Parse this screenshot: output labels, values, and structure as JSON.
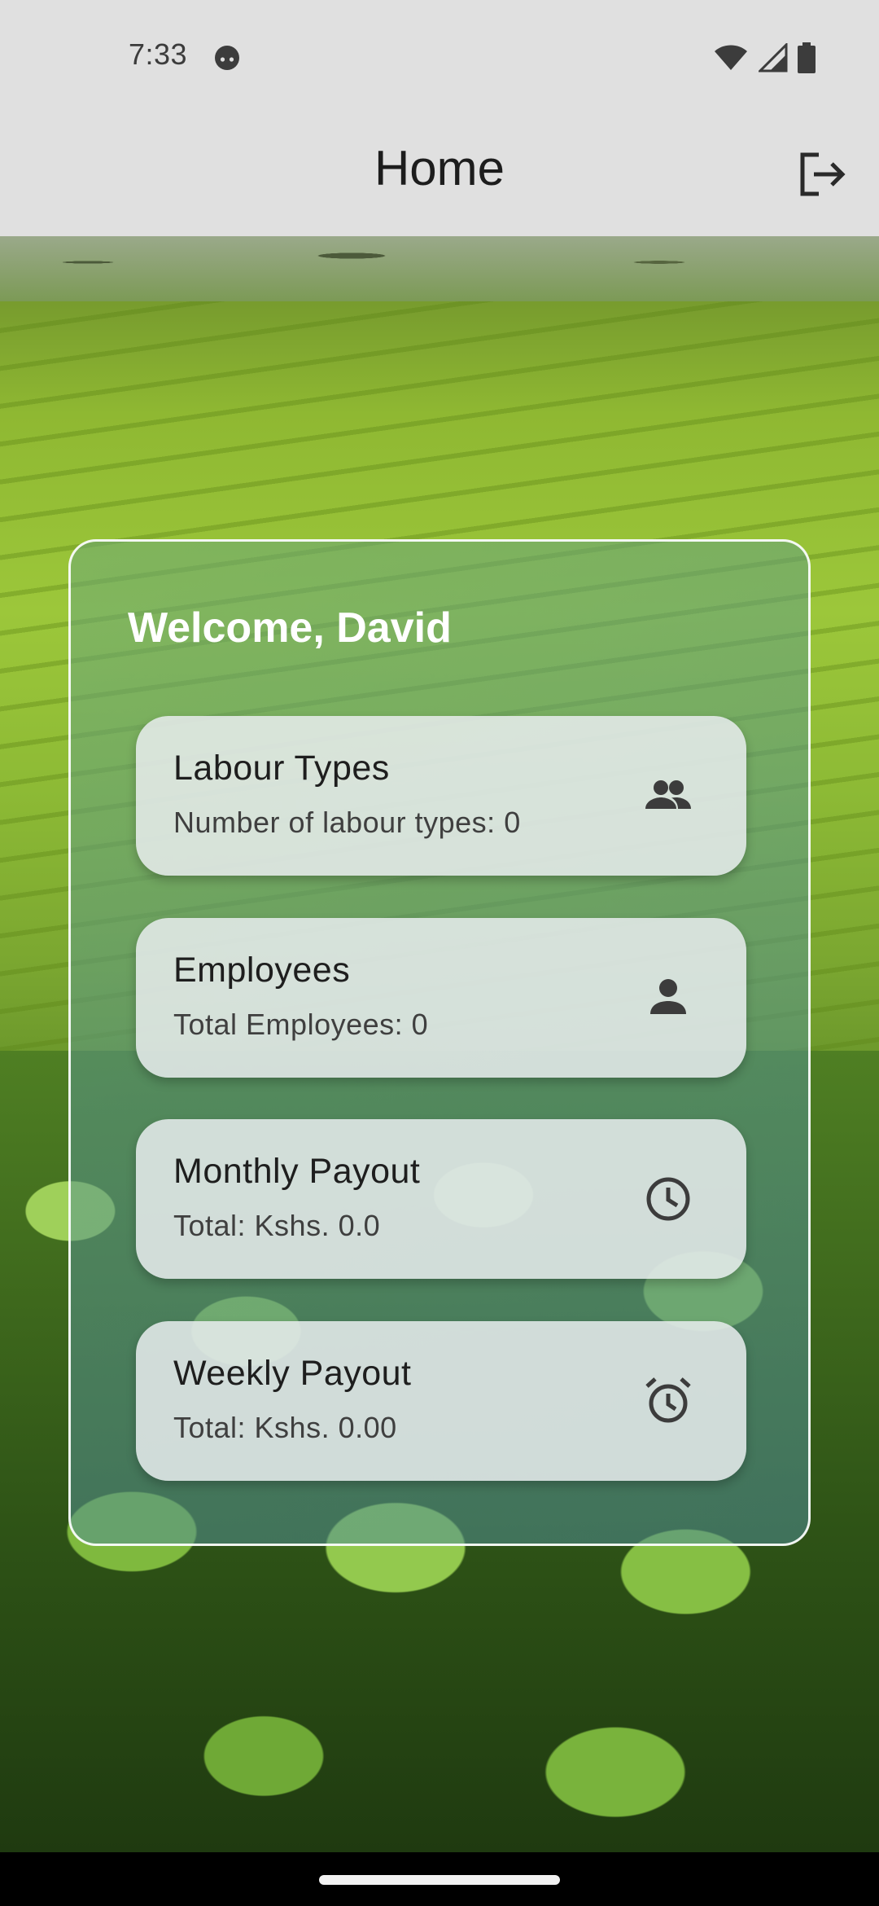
{
  "status_bar": {
    "time": "7:33",
    "app_icon": "android-face-icon",
    "icons": [
      "wifi-icon",
      "signal-icon",
      "battery-icon"
    ]
  },
  "app_bar": {
    "title": "Home",
    "action_icon": "logout-icon"
  },
  "background": {
    "image": "tea-plantation-photo"
  },
  "card": {
    "welcome": "Welcome, David",
    "tiles": [
      {
        "title": "Labour Types",
        "subtitle": "Number of labour types: 0",
        "icon": "people-icon"
      },
      {
        "title": "Employees",
        "subtitle": "Total Employees: 0",
        "icon": "person-icon"
      },
      {
        "title": "Monthly Payout",
        "subtitle": "Total: Kshs. 0.0",
        "icon": "clock-icon"
      },
      {
        "title": "Weekly Payout",
        "subtitle": "Total: Kshs. 0.00",
        "icon": "alarm-icon"
      }
    ]
  },
  "colors": {
    "bar_bg": "#e0e0e0",
    "tile_bg": "#e8ecee",
    "icon": "#3c3c3c",
    "welcome_text": "#ffffff"
  }
}
